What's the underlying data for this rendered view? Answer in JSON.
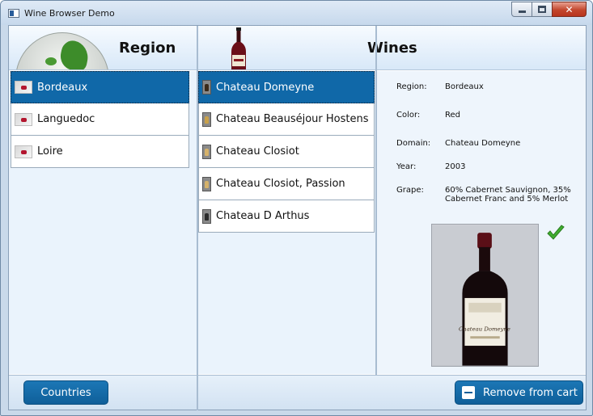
{
  "window": {
    "title": "Wine Browser Demo"
  },
  "headers": {
    "region": "Region",
    "wines": "Wines"
  },
  "regions": [
    {
      "label": "Bordeaux",
      "selected": true,
      "dot": "#b3152e"
    },
    {
      "label": "Languedoc",
      "selected": false,
      "dot": "#b3152e"
    },
    {
      "label": "Loire",
      "selected": false,
      "dot": "#b3152e"
    }
  ],
  "wines": [
    {
      "label": "Chateau Domeyne",
      "selected": true,
      "bottle": "#3a2a1a"
    },
    {
      "label": "Chateau Beauséjour Hostens",
      "selected": false,
      "bottle": "#c9a14a"
    },
    {
      "label": "Chateau Closiot",
      "selected": false,
      "bottle": "#d6b26a"
    },
    {
      "label": "Chateau Closiot, Passion",
      "selected": false,
      "bottle": "#d6b26a"
    },
    {
      "label": "Chateau D Arthus",
      "selected": false,
      "bottle": "#2b2b2b"
    }
  ],
  "detail": {
    "region_label": "Region:",
    "region": "Bordeaux",
    "color_label": "Color:",
    "color": "Red",
    "domain_label": "Domain:",
    "domain": "Chateau Domeyne",
    "year_label": "Year:",
    "year": "2003",
    "grape_label": "Grape:",
    "grape": "60% Cabernet Sauvignon, 35% Cabernet Franc and 5% Merlot",
    "bottle_label_text": "Chateau Domeyne",
    "in_cart_icon": "checkmark-icon"
  },
  "buttons": {
    "countries": "Countries",
    "remove": "Remove from cart"
  },
  "colors": {
    "accent": "#1068a8",
    "check": "#3fae2f"
  }
}
